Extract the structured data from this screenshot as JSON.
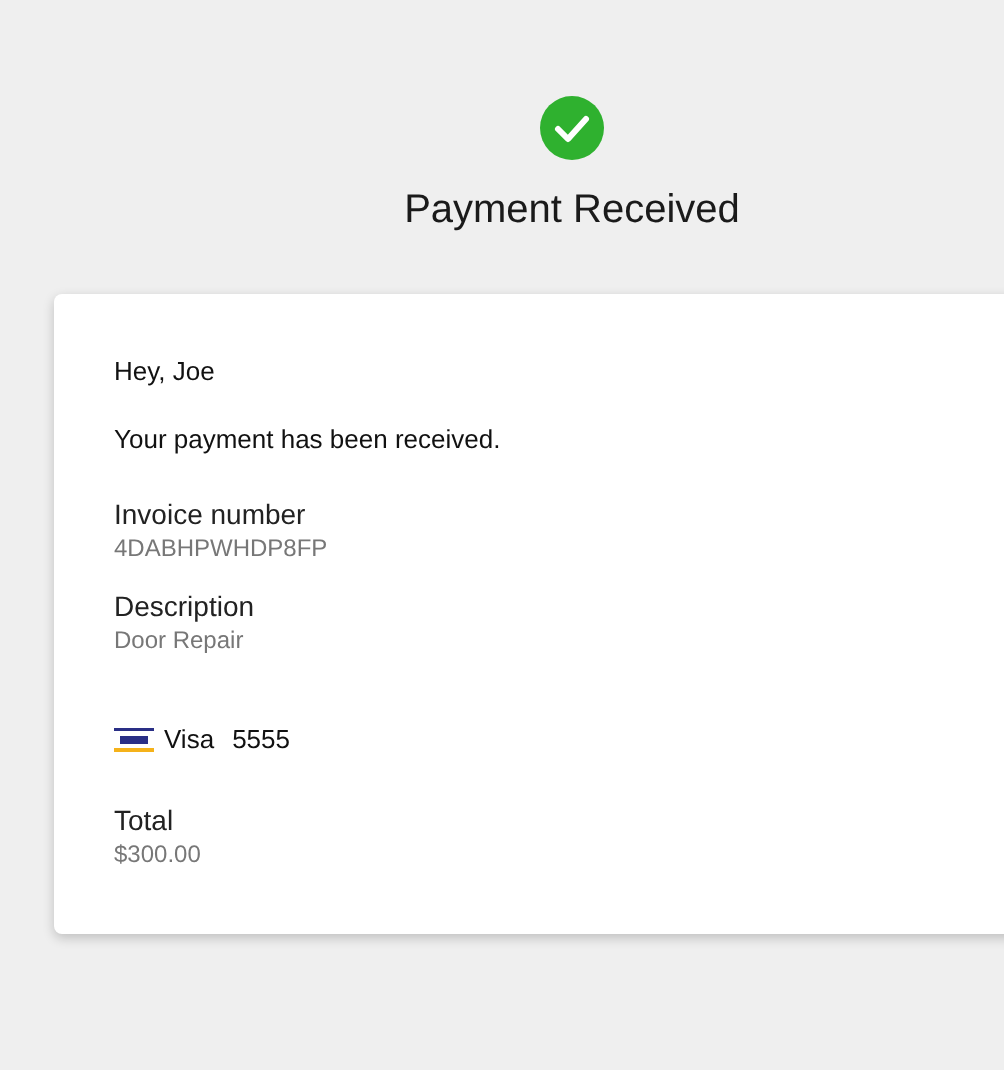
{
  "header": {
    "title": "Payment Received"
  },
  "receipt": {
    "greeting": "Hey, Joe",
    "message": "Your payment has been received.",
    "fields": [
      {
        "label": "Invoice number",
        "value": "4DABHPWHDP8FP"
      },
      {
        "label": "Description",
        "value": "Door Repair"
      }
    ],
    "card": {
      "brand": "Visa",
      "last4": "5555"
    },
    "total": {
      "label": "Total",
      "value": "$300.00"
    }
  }
}
